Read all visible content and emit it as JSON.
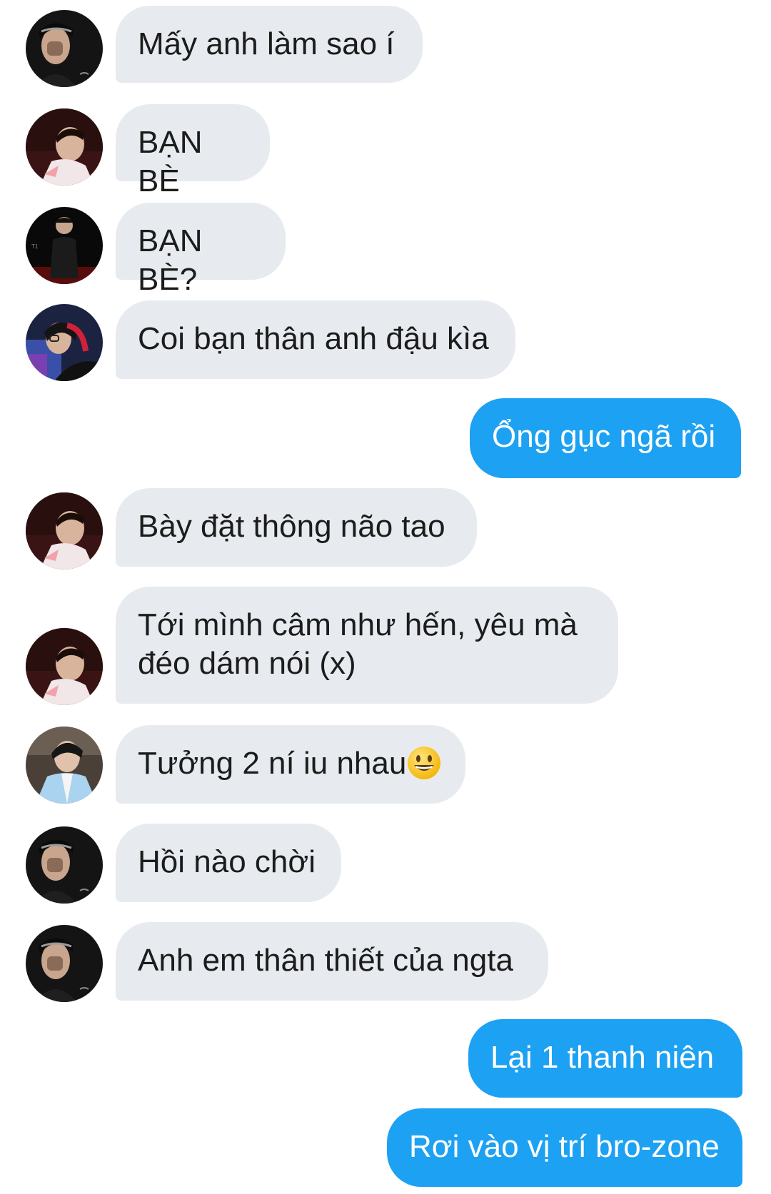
{
  "colors": {
    "incoming_bubble": "#e7ebef",
    "outgoing_bubble": "#1da1f2",
    "text": "#1c1c1c"
  },
  "messages": [
    {
      "sender": "incoming",
      "avatar": "avatar-a",
      "text": "Mấy anh làm sao í"
    },
    {
      "sender": "incoming",
      "avatar": "avatar-b",
      "text": "BẠN BÈ"
    },
    {
      "sender": "incoming",
      "avatar": "avatar-c",
      "text": "BẠN BÈ?"
    },
    {
      "sender": "incoming",
      "avatar": "avatar-d",
      "text": "Coi bạn thân anh đậu kìa"
    },
    {
      "sender": "outgoing",
      "text": "Ổng gục ngã rồi"
    },
    {
      "sender": "incoming",
      "avatar": "avatar-b",
      "text": "Bày đặt thông não tao"
    },
    {
      "sender": "incoming",
      "avatar": "avatar-b",
      "text": "Tới mình câm như hến, yêu mà đéo dám nói (x)"
    },
    {
      "sender": "incoming",
      "avatar": "avatar-e",
      "text": "Tưởng 2 ní iu nhau",
      "emoji": "grinning-face-emoji"
    },
    {
      "sender": "incoming",
      "avatar": "avatar-a",
      "text": "Hồi nào chời"
    },
    {
      "sender": "incoming",
      "avatar": "avatar-a",
      "text": "Anh em thân thiết của ngta"
    },
    {
      "sender": "outgoing",
      "text": "Lại 1 thanh niên"
    },
    {
      "sender": "outgoing",
      "text": "Rơi vào vị trí bro-zone"
    }
  ]
}
